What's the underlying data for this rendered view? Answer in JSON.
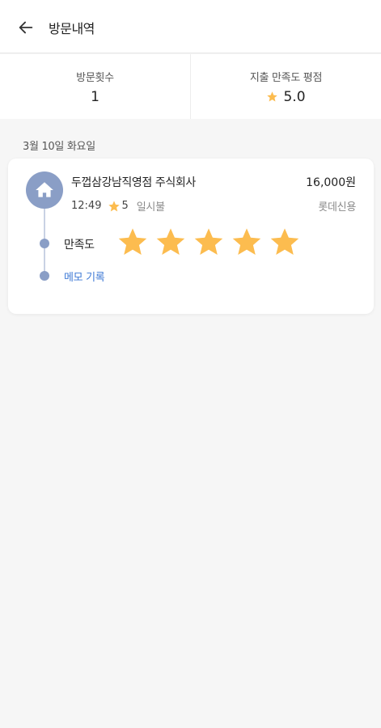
{
  "header": {
    "title": "방문내역",
    "back_icon": "arrow-left-icon"
  },
  "summary": {
    "visits_label": "방문횟수",
    "visits_value": "1",
    "rating_label": "지출 만족도 평점",
    "rating_value": "5.0",
    "rating_icon": "star-icon"
  },
  "date_label": "3월 10일 화요일",
  "visit": {
    "merchant": "두껍삼강남직영점 주식회사",
    "amount": "16,000원",
    "time": "12:49",
    "rating": "5",
    "plan": "일시불",
    "card_type": "롯데신용",
    "satisfaction_label": "만족도",
    "satisfaction_stars": 5,
    "memo_label": "메모 기록",
    "category_icon": "home-icon"
  },
  "colors": {
    "star": "#fcbc4f",
    "accent_blue": "#3f7ad6",
    "timeline": "#8a9ec6"
  }
}
